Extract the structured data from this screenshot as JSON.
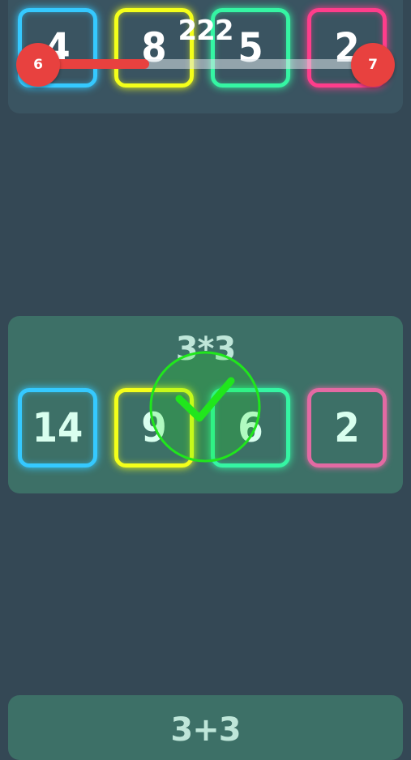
{
  "top_card": {
    "question": "",
    "options": [
      {
        "value": "4",
        "color": "#35c9ff"
      },
      {
        "value": "8",
        "color": "#f4ff1a"
      },
      {
        "value": "5",
        "color": "#35f5a3"
      },
      {
        "value": "2",
        "color": "#ff3d8b"
      }
    ]
  },
  "hud": {
    "score": "222",
    "current_level": "6",
    "next_level": "7",
    "progress_fraction": 0.33
  },
  "middle_card": {
    "question": "3*3",
    "options": [
      {
        "value": "14",
        "color": "#35c9ff"
      },
      {
        "value": "9",
        "color": "#f4ff1a"
      },
      {
        "value": "6",
        "color": "#35f5a3"
      },
      {
        "value": "2",
        "color": "#e36aa3"
      }
    ],
    "result": "correct",
    "result_icon": "check-icon",
    "result_color": "#20e61c"
  },
  "bottom_card": {
    "question": "3+3"
  }
}
